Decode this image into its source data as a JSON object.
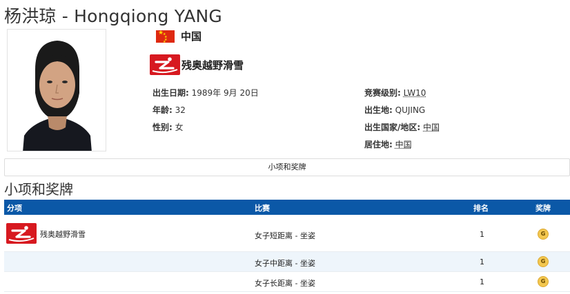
{
  "athlete": {
    "name": "杨洪琼 - Hongqiong YANG",
    "country": "中国",
    "sport": "残奥越野滑雪",
    "sport_icon": "para-cross-country-skiing-icon",
    "flag_icon": "china-flag-icon",
    "colors": {
      "flag_red": "#de2910",
      "flag_star": "#ffde00",
      "sport_red": "#d71920"
    }
  },
  "info_left": [
    {
      "label": "出生日期:",
      "value": "1989年 9月 20日"
    },
    {
      "label": "年龄:",
      "value": "32"
    },
    {
      "label": "性别:",
      "value": "女"
    }
  ],
  "info_right": [
    {
      "label": "竞赛级别:",
      "value": "LW10"
    },
    {
      "label": "出生地:",
      "value": "QUJING"
    },
    {
      "label": "出生国家/地区:",
      "value": "中国"
    },
    {
      "label": "居住地:",
      "value": "中国"
    }
  ],
  "tab": {
    "label": "小项和奖牌"
  },
  "section": {
    "title": "小项和奖牌"
  },
  "table": {
    "header_bg": "#0b58a7",
    "headers": {
      "discipline": "分项",
      "event": "比赛",
      "rank": "排名",
      "medal": "奖牌"
    },
    "discipline": "残奥越野滑雪",
    "rows": [
      {
        "event": "女子短距离 - 坐姿",
        "rank": "1",
        "medal": "G"
      },
      {
        "event": "女子中距离 - 坐姿",
        "rank": "1",
        "medal": "G"
      },
      {
        "event": "女子长距离 - 坐姿",
        "rank": "1",
        "medal": "G"
      }
    ],
    "medal_color": "#f3c74f"
  }
}
